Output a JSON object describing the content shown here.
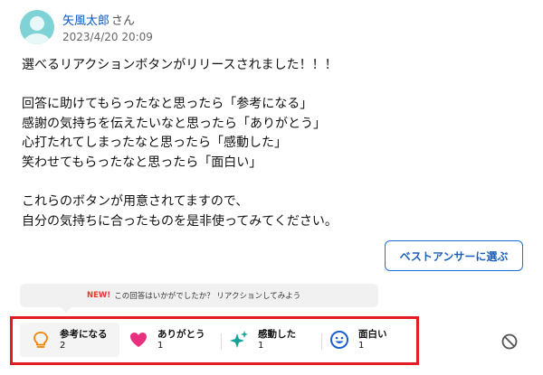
{
  "user": {
    "name": "矢風太郎",
    "suffix": "さん",
    "timestamp": "2023/4/20 20:09"
  },
  "answer": {
    "paragraphs": [
      "選べるリアクションボタンがリリースされました！！！",
      "回答に助けてもらったなと思ったら「参考になる」\n感謝の気持ちを伝えたいなと思ったら「ありがとう」\n心打たれてしまったなと思ったら「感動した」\n笑わせてもらったなと思ったら「面白い」",
      "これらのボタンが用意されてますので、\n自分の気持ちに合ったものを是非使ってみてください。"
    ]
  },
  "best_answer_button": "ベストアンサーに選ぶ",
  "reaction_prompt": {
    "badge": "NEW!",
    "text": "この回答はいかがでしたか？ リアクションしてみよう"
  },
  "reactions": [
    {
      "label": "参考になる",
      "count": "2",
      "icon": "lightbulb-icon",
      "color": "#f08300"
    },
    {
      "label": "ありがとう",
      "count": "1",
      "icon": "heart-icon",
      "color": "#e8307f"
    },
    {
      "label": "感動した",
      "count": "1",
      "icon": "sparkle-icon",
      "color": "#14a39a"
    },
    {
      "label": "面白い",
      "count": "1",
      "icon": "smile-icon",
      "color": "#1a5fd0"
    }
  ],
  "block_icon": "block-icon",
  "colors": {
    "highlight": "#e31b23",
    "link": "#0a58c2",
    "accent": "#1a6fd6"
  }
}
